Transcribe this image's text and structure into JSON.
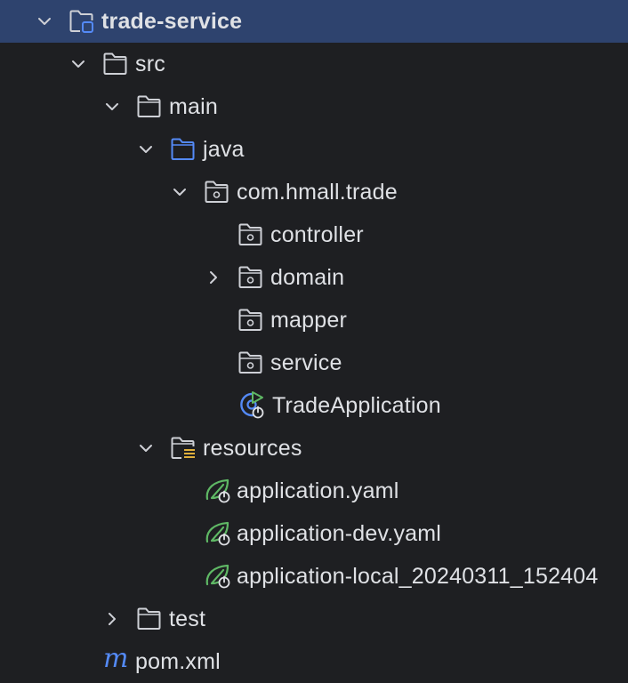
{
  "tree": {
    "root": {
      "label": "trade-service"
    },
    "src": {
      "label": "src"
    },
    "main": {
      "label": "main"
    },
    "java": {
      "label": "java"
    },
    "package": {
      "label": "com.hmall.trade"
    },
    "controller": {
      "label": "controller"
    },
    "domain": {
      "label": "domain"
    },
    "mapper": {
      "label": "mapper"
    },
    "service": {
      "label": "service"
    },
    "app_class": {
      "label": "TradeApplication"
    },
    "resources": {
      "label": "resources"
    },
    "yaml1": {
      "label": "application.yaml"
    },
    "yaml2": {
      "label": "application-dev.yaml"
    },
    "yaml3": {
      "label": "application-local_20240311_152404"
    },
    "test": {
      "label": "test"
    },
    "pom": {
      "label": "pom.xml",
      "icon_glyph": "m"
    }
  },
  "colors": {
    "background": "#1e1f22",
    "selection": "#2e436e",
    "text": "#dfe1e5",
    "folder_outline": "#ced0d6",
    "source_folder": "#548af7",
    "spring_green": "#5fb865",
    "run_green": "#5fb865"
  },
  "icons": {
    "chevron_expanded": "chevron-down-icon",
    "chevron_collapsed": "chevron-right-icon",
    "module": "module-folder-icon",
    "folder": "folder-icon",
    "source_root": "source-folder-icon",
    "package": "package-icon",
    "resources": "resources-folder-icon",
    "spring_boot_app": "spring-boot-class-icon",
    "spring_config": "spring-config-icon",
    "maven": "maven-icon"
  }
}
